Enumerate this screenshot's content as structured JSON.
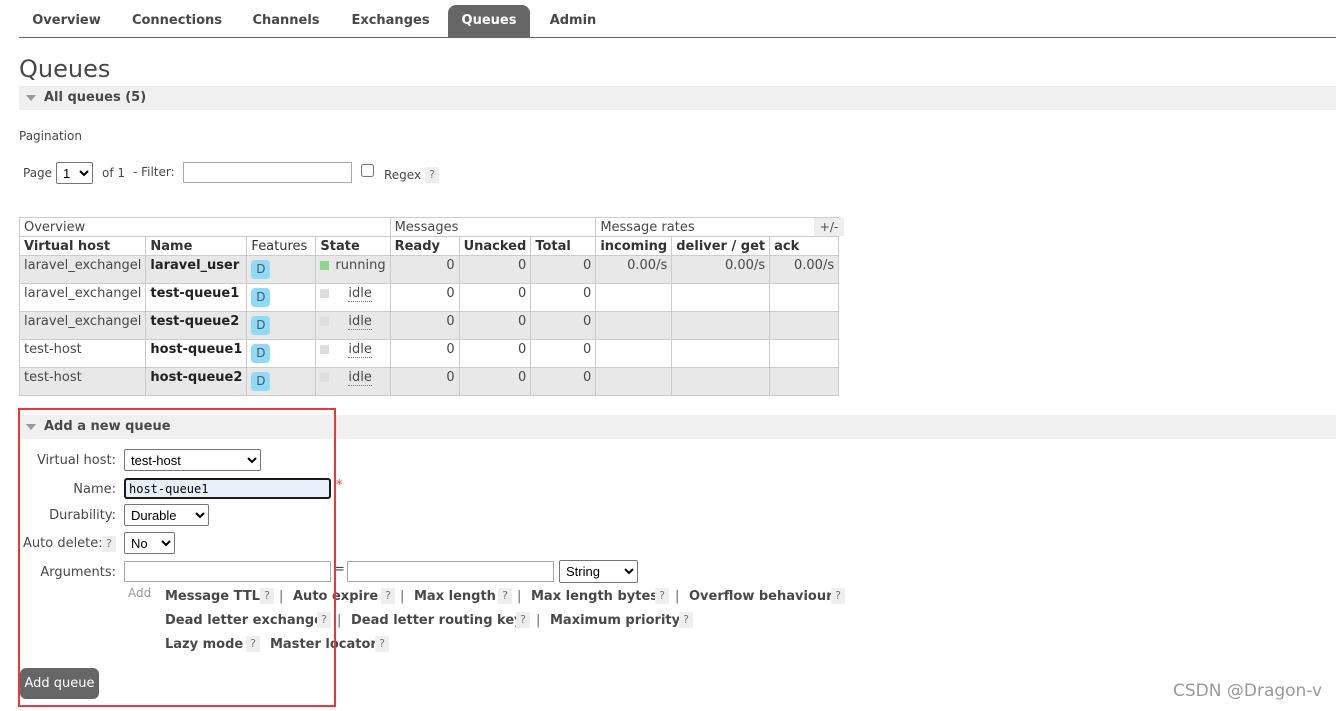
{
  "tabs": [
    "Overview",
    "Connections",
    "Channels",
    "Exchanges",
    "Queues",
    "Admin"
  ],
  "page_title": "Queues",
  "all_queues_label": "All queues (5)",
  "pagination": {
    "title": "Pagination",
    "page_label": "Page",
    "page_value": "1",
    "of_label": "of 1",
    "filter_label": "- Filter:",
    "filter_value": "",
    "regex_label": "Regex",
    "help": "?"
  },
  "table": {
    "group_headers": [
      "Overview",
      "Messages",
      "Message rates"
    ],
    "plus_minus": "+/-",
    "columns": [
      "Virtual host",
      "Name",
      "Features",
      "State",
      "Ready",
      "Unacked",
      "Total",
      "incoming",
      "deliver / get",
      "ack"
    ],
    "rows": [
      {
        "vhost": "laravel_exchangel",
        "name": "laravel_user",
        "feature": "D",
        "state": "running",
        "ready": "0",
        "unacked": "0",
        "total": "0",
        "incoming": "0.00/s",
        "deliver": "0.00/s",
        "ack": "0.00/s"
      },
      {
        "vhost": "laravel_exchangel",
        "name": "test-queue1",
        "feature": "D",
        "state": "idle",
        "ready": "0",
        "unacked": "0",
        "total": "0",
        "incoming": "",
        "deliver": "",
        "ack": ""
      },
      {
        "vhost": "laravel_exchangel",
        "name": "test-queue2",
        "feature": "D",
        "state": "idle",
        "ready": "0",
        "unacked": "0",
        "total": "0",
        "incoming": "",
        "deliver": "",
        "ack": ""
      },
      {
        "vhost": "test-host",
        "name": "host-queue1",
        "feature": "D",
        "state": "idle",
        "ready": "0",
        "unacked": "0",
        "total": "0",
        "incoming": "",
        "deliver": "",
        "ack": ""
      },
      {
        "vhost": "test-host",
        "name": "host-queue2",
        "feature": "D",
        "state": "idle",
        "ready": "0",
        "unacked": "0",
        "total": "0",
        "incoming": "",
        "deliver": "",
        "ack": ""
      }
    ]
  },
  "add_queue": {
    "section_label": "Add a new queue",
    "virtual_host_label": "Virtual host:",
    "virtual_host_value": "test-host",
    "name_label": "Name:",
    "name_value": "host-queue1",
    "required_mark": "*",
    "durability_label": "Durability:",
    "durability_value": "Durable",
    "auto_delete_label": "Auto delete:",
    "auto_delete_value": "No",
    "arguments_label": "Arguments:",
    "equals": "=",
    "arg_type_value": "String",
    "add_label": "Add",
    "hints": [
      "Message TTL",
      "Auto expire",
      "Max length",
      "Max length bytes",
      "Overflow behaviour",
      "Dead letter exchange",
      "Dead letter routing key",
      "Maximum priority",
      "Lazy mode",
      "Master locator"
    ],
    "separator": "|",
    "submit_label": "Add queue"
  },
  "watermark": "CSDN @Dragon-v",
  "colors": {
    "tab_active": "#666666",
    "badge": "#8fdbf5",
    "running": "#8dd58f",
    "highlight_box": "#e33b3b"
  }
}
